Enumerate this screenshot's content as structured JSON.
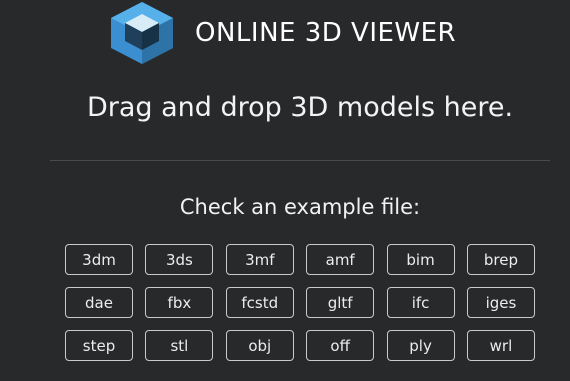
{
  "header": {
    "title": "ONLINE 3D VIEWER",
    "logo_icon": "cube-logo-icon"
  },
  "main": {
    "drop_text": "Drag and drop 3D models here.",
    "example_title": "Check an example file:",
    "examples": [
      "3dm",
      "3ds",
      "3mf",
      "amf",
      "bim",
      "brep",
      "dae",
      "fbx",
      "fcstd",
      "gltf",
      "ifc",
      "iges",
      "step",
      "stl",
      "obj",
      "off",
      "ply",
      "wrl"
    ]
  },
  "colors": {
    "background": "#28292b",
    "logo_light": "#4aa3df",
    "logo_dark": "#2f6f9e",
    "button_border": "#c9cacc"
  }
}
